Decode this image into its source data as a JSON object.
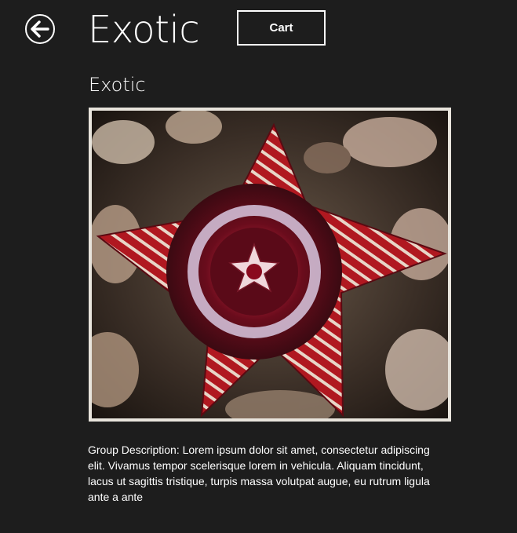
{
  "header": {
    "back_icon": "back-arrow-icon",
    "title": "Exotic",
    "cart_label": "Cart"
  },
  "group": {
    "subtitle": "Exotic",
    "image_icon": "exotic-flower-image",
    "description": "Group Description: Lorem ipsum dolor sit amet, consectetur adipiscing elit. Vivamus tempor scelerisque lorem in vehicula. Aliquam tincidunt, lacus ut sagittis tristique, turpis massa volutpat augue, eu rutrum ligula ante a ante"
  },
  "colors": {
    "background": "#1d1d1d",
    "text": "#ffffff",
    "flower_red": "#a3141c",
    "flower_dark": "#3b0a12"
  }
}
